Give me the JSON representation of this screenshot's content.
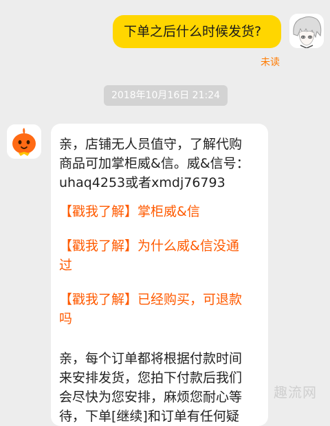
{
  "outgoing": {
    "text": "下单之后什么时候发货?",
    "status": "未读"
  },
  "timestamp": "2018年10月16日 21:24",
  "incoming": {
    "intro_lines": [
      "亲，店铺无人员值守，了解代购",
      "商品可加掌柜威&信。威&信号：",
      "uhaq4253或者xmdj76793"
    ],
    "links": [
      {
        "lines": [
          "【戳我了解】掌柜威&信"
        ]
      },
      {
        "lines": [
          "【戳我了解】为什么威&信没通",
          "过"
        ]
      },
      {
        "lines": [
          "【戳我了解】已经购买，可退款",
          "吗"
        ]
      }
    ],
    "closing_lines": [
      "亲，每个订单都将根据付款时间",
      "来安排发货，您拍下付款后我们",
      "会尽快为您安排，麻烦您耐心等",
      "待，下单[继续]和订单有任何疑"
    ]
  },
  "watermark": "趣流网",
  "colors": {
    "background": "#ededed",
    "outgoing_bubble": "#ffd600",
    "incoming_bubble": "#ffffff",
    "link": "#ff5a00",
    "unread": "#ff7a00",
    "timestamp_bg": "#d3d3d3"
  }
}
